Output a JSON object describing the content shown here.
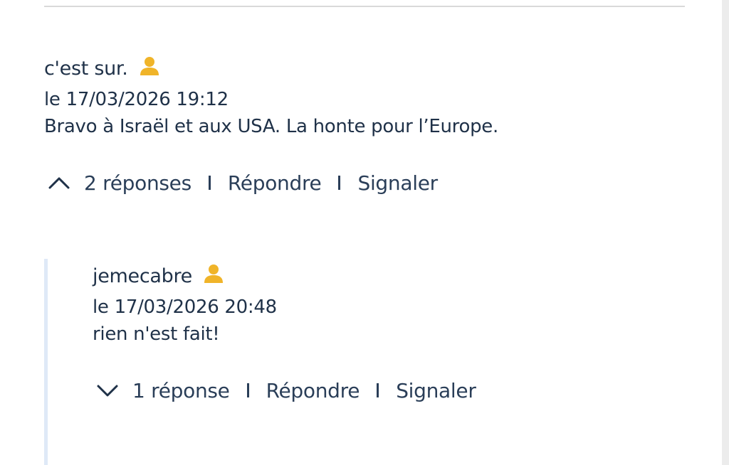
{
  "colors": {
    "text": "#1f3148",
    "icon_accent": "#f0b429",
    "reply_bar": "#dfe9f7",
    "divider": "#d9d9d9"
  },
  "comments": [
    {
      "author": "c'est sur.",
      "author_icon": "user-icon",
      "date": "le 17/03/2026 19:12",
      "text": "Bravo à Israël et aux USA. La honte pour l’Europe.",
      "toggle_icon": "chevron-up-icon",
      "replies_label": "2 réponses",
      "reply_label": "Répondre",
      "report_label": "Signaler"
    },
    {
      "author": "jemecabre",
      "author_icon": "user-icon",
      "date": "le 17/03/2026 20:48",
      "text": "rien n'est fait!",
      "toggle_icon": "chevron-down-icon",
      "replies_label": "1 réponse",
      "reply_label": "Répondre",
      "report_label": "Signaler"
    }
  ]
}
